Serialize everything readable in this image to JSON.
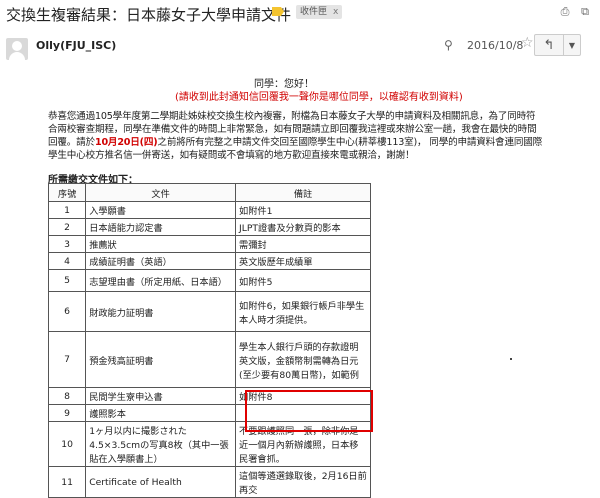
{
  "header": {
    "subject": "交換生複審結果：日本藤女子大學申請文件",
    "label": "收件匣",
    "label_close": "x"
  },
  "icons": {
    "tag": "label-tag-icon",
    "print": "print-icon",
    "new_window": "new-window-icon",
    "attachment": "paperclip-icon",
    "star": "star-icon",
    "reply": "reply-icon",
    "more": "chevron-down-icon"
  },
  "message": {
    "sender": "Olly(FJU_ISC)",
    "date": "2016/10/8",
    "greeting": "同學：您好！",
    "notice": "(請收到此封通知信回覆我一聲你是哪位同學，以確認有收到資料)",
    "para": [
      "恭喜您通過105學年度第二學期赴姊妹校交換生校內複審，附檔為日本藤女子大學的申請資料及相關訊息，為了同時符",
      "合兩校審查期程，同學在準備文件的時間上非常緊急，如有問題請立即回覆我這裡或來辦公室一趟，我會在最快的時間",
      "回覆。請於",
      "10月20日(四)",
      "之前將所有完整之申請文件交回至國際學生中心(耕莘樓113室)， 同學的申請資料會連同國際",
      "學生中心校方推名信一併寄送，如有疑問或不會填寫的地方歡迎直接來電或親洽，謝謝！"
    ],
    "table_title": "所需繳交文件如下：",
    "table": {
      "headers": [
        "序號",
        "文件",
        "備註"
      ],
      "rows": [
        [
          "1",
          "入學願書",
          "如附件1"
        ],
        [
          "2",
          "日本語能力認定書",
          "JLPT證書及分數頁的影本"
        ],
        [
          "3",
          "推薦狀",
          "需彌封"
        ],
        [
          "4",
          "成績証明書（英語）",
          "英文版歷年成績單"
        ],
        [
          "5",
          "志望理由書（所定用紙、日本語）",
          "如附件5"
        ],
        [
          "6",
          "財政能力証明書",
          "如附件6，如果銀行帳戶非學生本人時才須提供。"
        ],
        [
          "7",
          "預金残高証明書",
          "學生本人銀行戶頭的存款證明英文版，金額幣制需轉為日元(至少要有80萬日幣)，如範例"
        ],
        [
          "8",
          "民間学生寮申込書",
          "如附件8"
        ],
        [
          "9",
          "護照影本",
          ""
        ],
        [
          "10",
          "1ヶ月以内に撮影された4.5×3.5cmの写真8枚（其中一張貼在入學願書上）",
          "不要跟護照同一張，除非你是近一個月內新辦護照，日本移民署會抓。"
        ],
        [
          "11",
          "Certificate of Health",
          "這個等遴選錄取後，2月16日前再交"
        ]
      ]
    }
  }
}
